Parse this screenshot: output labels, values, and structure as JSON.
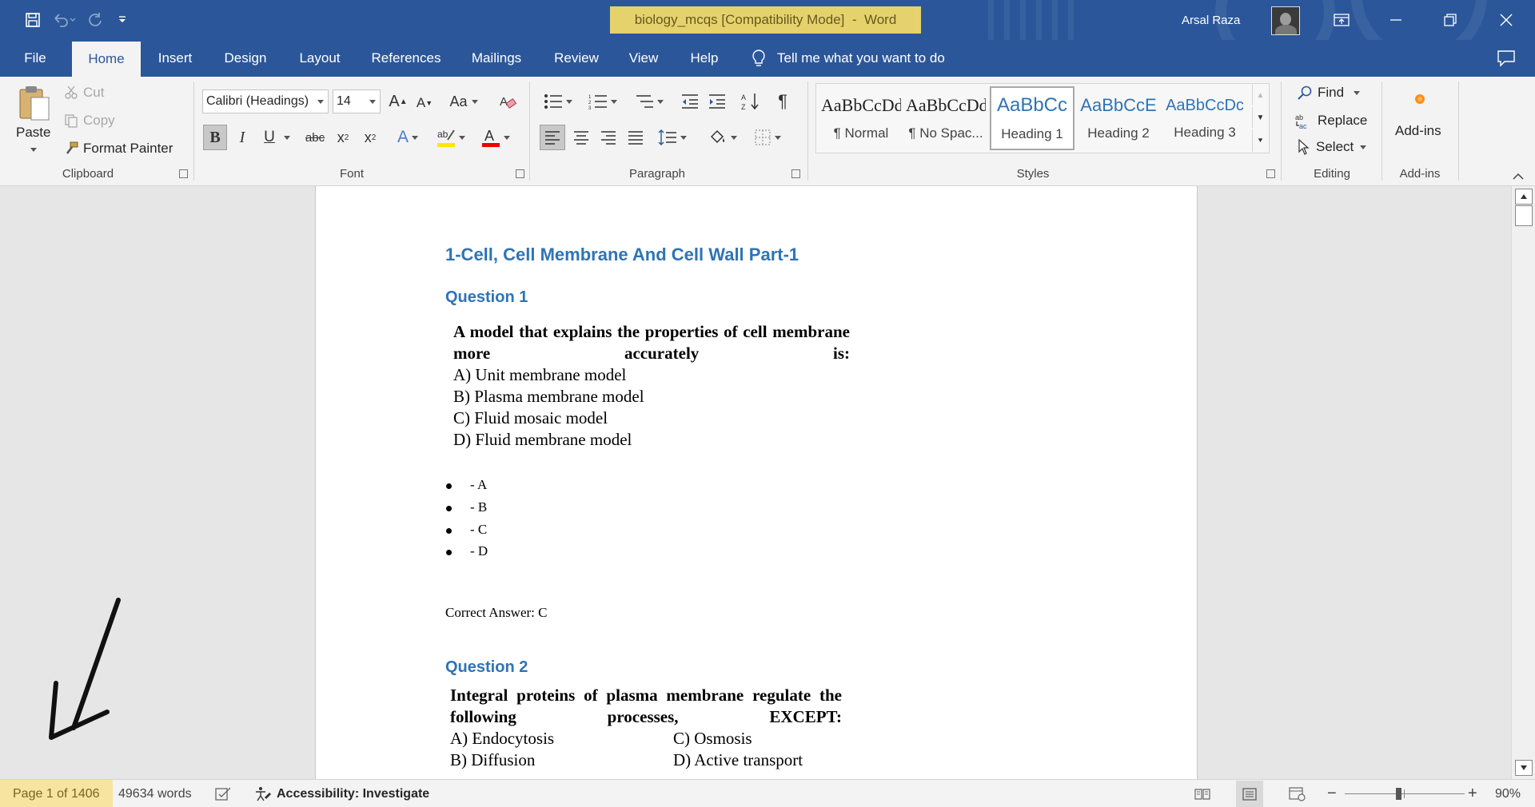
{
  "titlebar": {
    "doc_name": "biology_mcqs [Compatibility Mode]",
    "separator": "-",
    "app_name": "Word",
    "user": "Arsal Raza",
    "icons": [
      "save-icon",
      "undo-icon",
      "redo-icon",
      "customize-qat-icon",
      "ribbon-display-icon",
      "minimize-icon",
      "restore-icon",
      "close-icon"
    ]
  },
  "tabs": [
    "File",
    "Home",
    "Insert",
    "Design",
    "Layout",
    "References",
    "Mailings",
    "Review",
    "View",
    "Help"
  ],
  "active_tab": "Home",
  "tell_me": "Tell me what you want to do",
  "ribbon": {
    "clipboard": {
      "label": "Clipboard",
      "paste": "Paste",
      "cut": "Cut",
      "copy": "Copy",
      "format_painter": "Format Painter"
    },
    "font": {
      "label": "Font",
      "font_name": "Calibri (Headings)",
      "font_size": "14",
      "change_case": "Aa"
    },
    "paragraph": {
      "label": "Paragraph"
    },
    "styles": {
      "label": "Styles",
      "items": [
        {
          "sample": "AaBbCcDd",
          "name": "¶ Normal"
        },
        {
          "sample": "AaBbCcDd",
          "name": "¶ No Spac..."
        },
        {
          "sample": "AaBbCc",
          "name": "Heading 1"
        },
        {
          "sample": "AaBbCcE",
          "name": "Heading 2"
        },
        {
          "sample": "AaBbCcDc",
          "name": "Heading 3"
        }
      ],
      "selected": "Heading 1"
    },
    "editing": {
      "label": "Editing",
      "find": "Find",
      "replace": "Replace",
      "select": "Select"
    },
    "addins": {
      "label": "Add-ins",
      "button": "Add-ins"
    }
  },
  "document": {
    "title": "1-Cell, Cell Membrane And Cell Wall Part-1",
    "q1": {
      "heading": "Question 1",
      "question": "A model that explains the properties of cell membrane more accurately is:",
      "options": [
        "A) Unit membrane model",
        "B) Plasma membrane model",
        "C) Fluid mosaic model",
        "D) Fluid membrane model"
      ],
      "bullets": [
        "- A",
        "- B",
        "- C",
        "- D"
      ],
      "answer": "Correct Answer: C"
    },
    "q2": {
      "heading": "Question 2",
      "question": "Integral proteins of plasma membrane regulate the following processes, EXCEPT:",
      "options": [
        "A) Endocytosis",
        "C) Osmosis",
        "B) Diffusion",
        "D) Active transport"
      ]
    }
  },
  "statusbar": {
    "page": "Page 1 of 1406",
    "words": "49634 words",
    "accessibility": "Accessibility: Investigate",
    "zoom": "90%"
  },
  "colors": {
    "brand": "#2b579a",
    "heading": "#2e74b5",
    "highlight": "#f1d96b"
  }
}
